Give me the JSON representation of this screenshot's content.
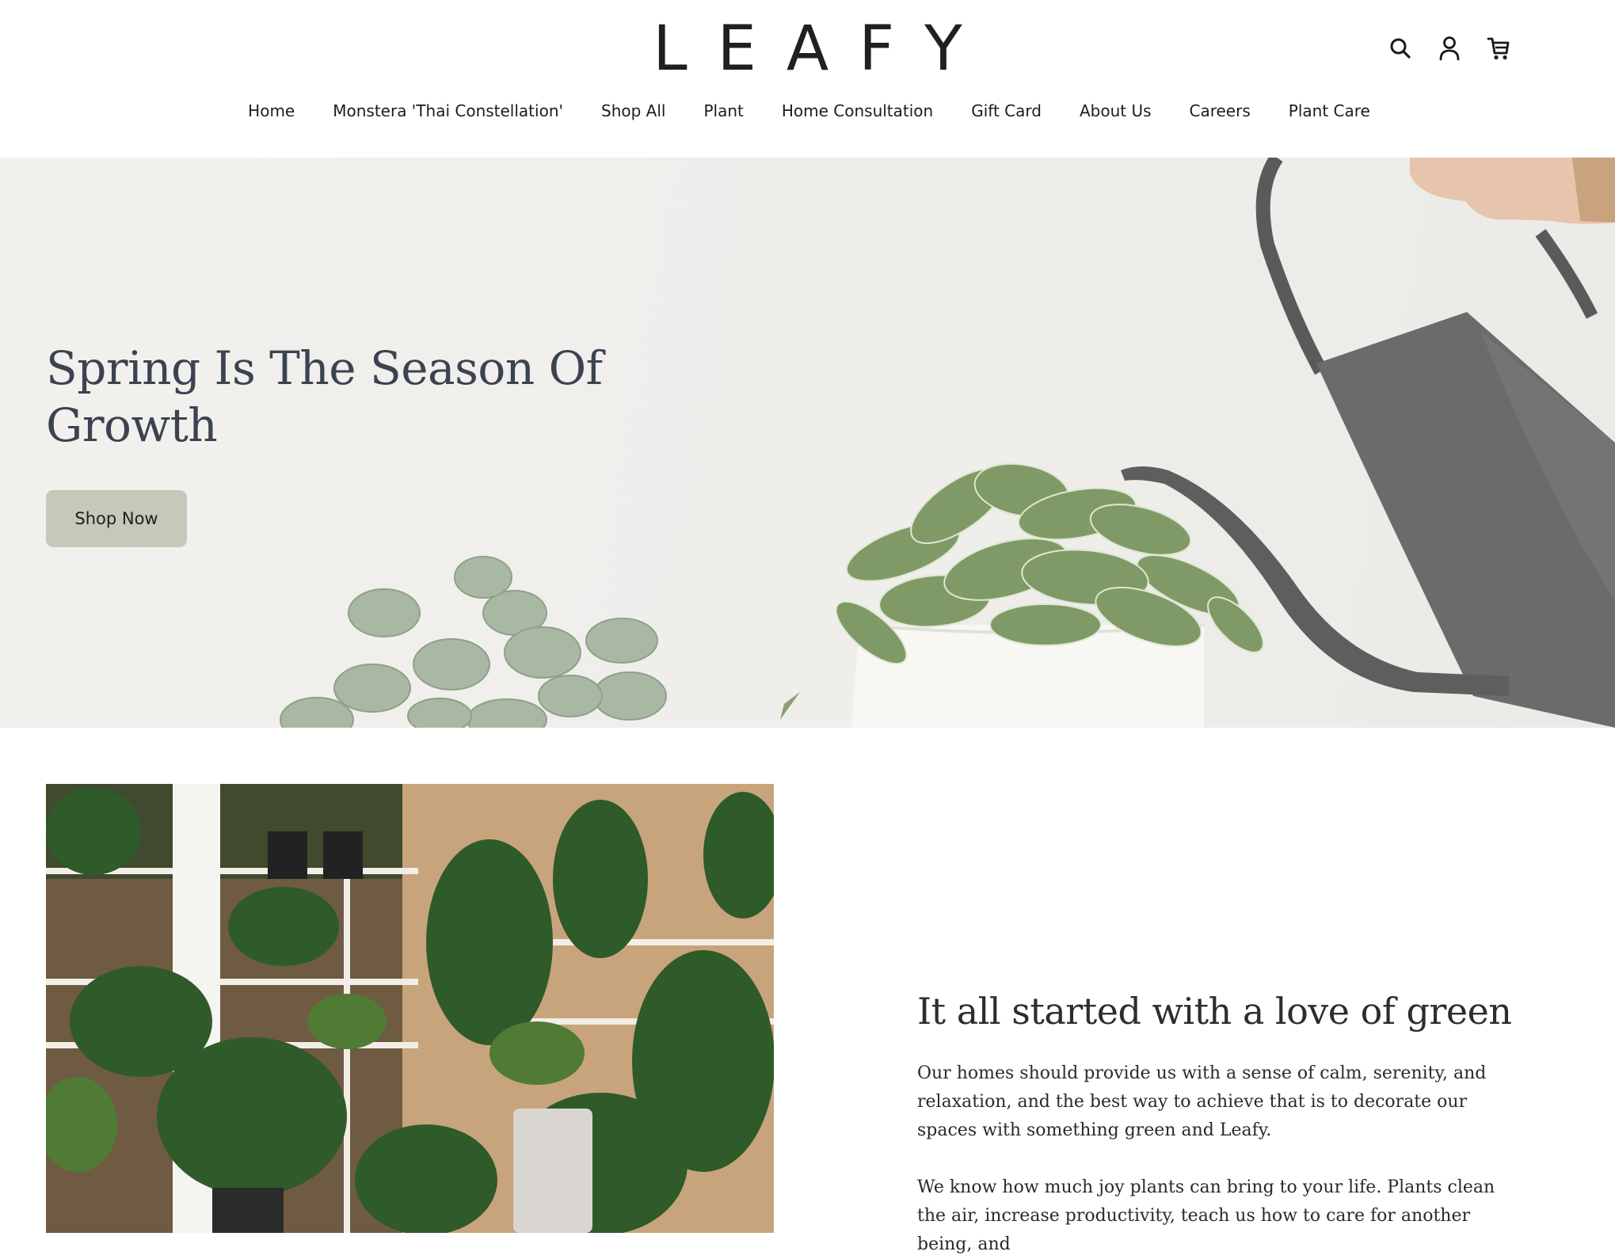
{
  "brand": {
    "logo_text": "LEAFY"
  },
  "header": {
    "icons": [
      "search-icon",
      "account-icon",
      "cart-icon"
    ]
  },
  "nav": {
    "items": [
      {
        "label": "Home"
      },
      {
        "label": "Monstera 'Thai Constellation'"
      },
      {
        "label": "Shop All"
      },
      {
        "label": "Plant"
      },
      {
        "label": "Home Consultation"
      },
      {
        "label": "Gift Card"
      },
      {
        "label": "About Us"
      },
      {
        "label": "Careers"
      },
      {
        "label": "Plant Care"
      }
    ]
  },
  "hero": {
    "title": "Spring Is The Season Of Growth",
    "cta_label": "Shop Now",
    "button_color": "#c6c8b9",
    "title_color": "#3b4350"
  },
  "story": {
    "title": "It all started with a love of green",
    "paragraph_1": "Our homes should provide us with a sense of calm, serenity, and relaxation, and the best way to achieve that is to decorate our spaces with something green and Leafy.",
    "paragraph_2": "We know how much joy plants can bring to your life. Plants clean the air, increase productivity, teach us how to care for another being, and"
  }
}
